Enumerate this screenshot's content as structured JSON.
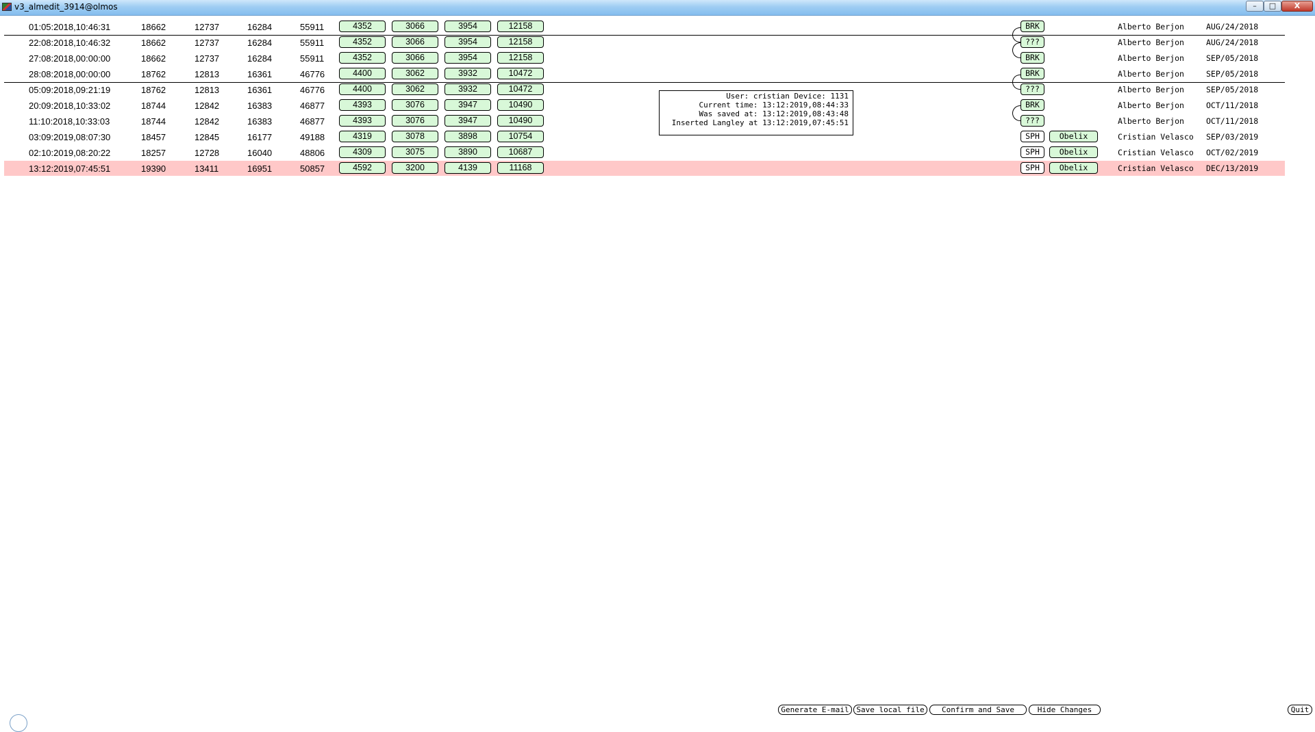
{
  "window": {
    "title": "v3_almedit_3914@olmos",
    "controls": {
      "minimize": "–",
      "maximize": "□",
      "close": "X"
    }
  },
  "rows": [
    {
      "date": "01:05:2018,10:46:31",
      "n1": "18662",
      "n2": "12737",
      "n3": "16284",
      "n4": "55911",
      "b1": "4352",
      "b2": "3066",
      "b3": "3954",
      "b4": "12158",
      "tag": "BRK",
      "tag2": "",
      "user": "Alberto Berjon",
      "udate": "AUG/24/2018"
    },
    {
      "date": "22:08:2018,10:46:32",
      "n1": "18662",
      "n2": "12737",
      "n3": "16284",
      "n4": "55911",
      "b1": "4352",
      "b2": "3066",
      "b3": "3954",
      "b4": "12158",
      "tag": "???",
      "tag2": "",
      "user": "Alberto Berjon",
      "udate": "AUG/24/2018"
    },
    {
      "date": "27:08:2018,00:00:00",
      "n1": "18662",
      "n2": "12737",
      "n3": "16284",
      "n4": "55911",
      "b1": "4352",
      "b2": "3066",
      "b3": "3954",
      "b4": "12158",
      "tag": "BRK",
      "tag2": "",
      "user": "Alberto Berjon",
      "udate": "SEP/05/2018"
    },
    {
      "date": "28:08:2018,00:00:00",
      "n1": "18762",
      "n2": "12813",
      "n3": "16361",
      "n4": "46776",
      "b1": "4400",
      "b2": "3062",
      "b3": "3932",
      "b4": "10472",
      "tag": "BRK",
      "tag2": "",
      "user": "Alberto Berjon",
      "udate": "SEP/05/2018"
    },
    {
      "date": "05:09:2018,09:21:19",
      "n1": "18762",
      "n2": "12813",
      "n3": "16361",
      "n4": "46776",
      "b1": "4400",
      "b2": "3062",
      "b3": "3932",
      "b4": "10472",
      "tag": "???",
      "tag2": "",
      "user": "Alberto Berjon",
      "udate": "SEP/05/2018"
    },
    {
      "date": "20:09:2018,10:33:02",
      "n1": "18744",
      "n2": "12842",
      "n3": "16383",
      "n4": "46877",
      "b1": "4393",
      "b2": "3076",
      "b3": "3947",
      "b4": "10490",
      "tag": "BRK",
      "tag2": "",
      "user": "Alberto Berjon",
      "udate": "OCT/11/2018"
    },
    {
      "date": "11:10:2018,10:33:03",
      "n1": "18744",
      "n2": "12842",
      "n3": "16383",
      "n4": "46877",
      "b1": "4393",
      "b2": "3076",
      "b3": "3947",
      "b4": "10490",
      "tag": "???",
      "tag2": "",
      "user": "Alberto Berjon",
      "udate": "OCT/11/2018"
    },
    {
      "date": "03:09:2019,08:07:30",
      "n1": "18457",
      "n2": "12845",
      "n3": "16177",
      "n4": "49188",
      "b1": "4319",
      "b2": "3078",
      "b3": "3898",
      "b4": "10754",
      "tag": "SPH",
      "tag2": "Obelix",
      "user": "Cristian Velasco",
      "udate": "SEP/03/2019"
    },
    {
      "date": "02:10:2019,08:20:22",
      "n1": "18257",
      "n2": "12728",
      "n3": "16040",
      "n4": "48806",
      "b1": "4309",
      "b2": "3075",
      "b3": "3890",
      "b4": "10687",
      "tag": "SPH",
      "tag2": "Obelix",
      "user": "Cristian Velasco",
      "udate": "OCT/02/2019"
    },
    {
      "date": "13:12:2019,07:45:51",
      "n1": "19390",
      "n2": "13411",
      "n3": "16951",
      "n4": "50857",
      "b1": "4592",
      "b2": "3200",
      "b3": "4139",
      "b4": "11168",
      "tag": "SPH",
      "tag2": "Obelix",
      "user": "Cristian Velasco",
      "udate": "DEC/13/2019"
    }
  ],
  "info": {
    "line1": "User: cristian Device: 1131",
    "line2": "Current time: 13:12:2019,08:44:33",
    "line3": "Was saved at: 13:12:2019,08:43:48",
    "line4": "Inserted Langley at 13:12:2019,07:45:51"
  },
  "buttons": {
    "generate_email": "Generate E-mail",
    "save_local": "Save local file",
    "confirm_save": "Confirm and Save",
    "hide_changes": "Hide Changes",
    "quit": "Quit"
  },
  "colors": {
    "box_green": "#d8f8d8",
    "highlight_row": "#ffc8c8"
  }
}
